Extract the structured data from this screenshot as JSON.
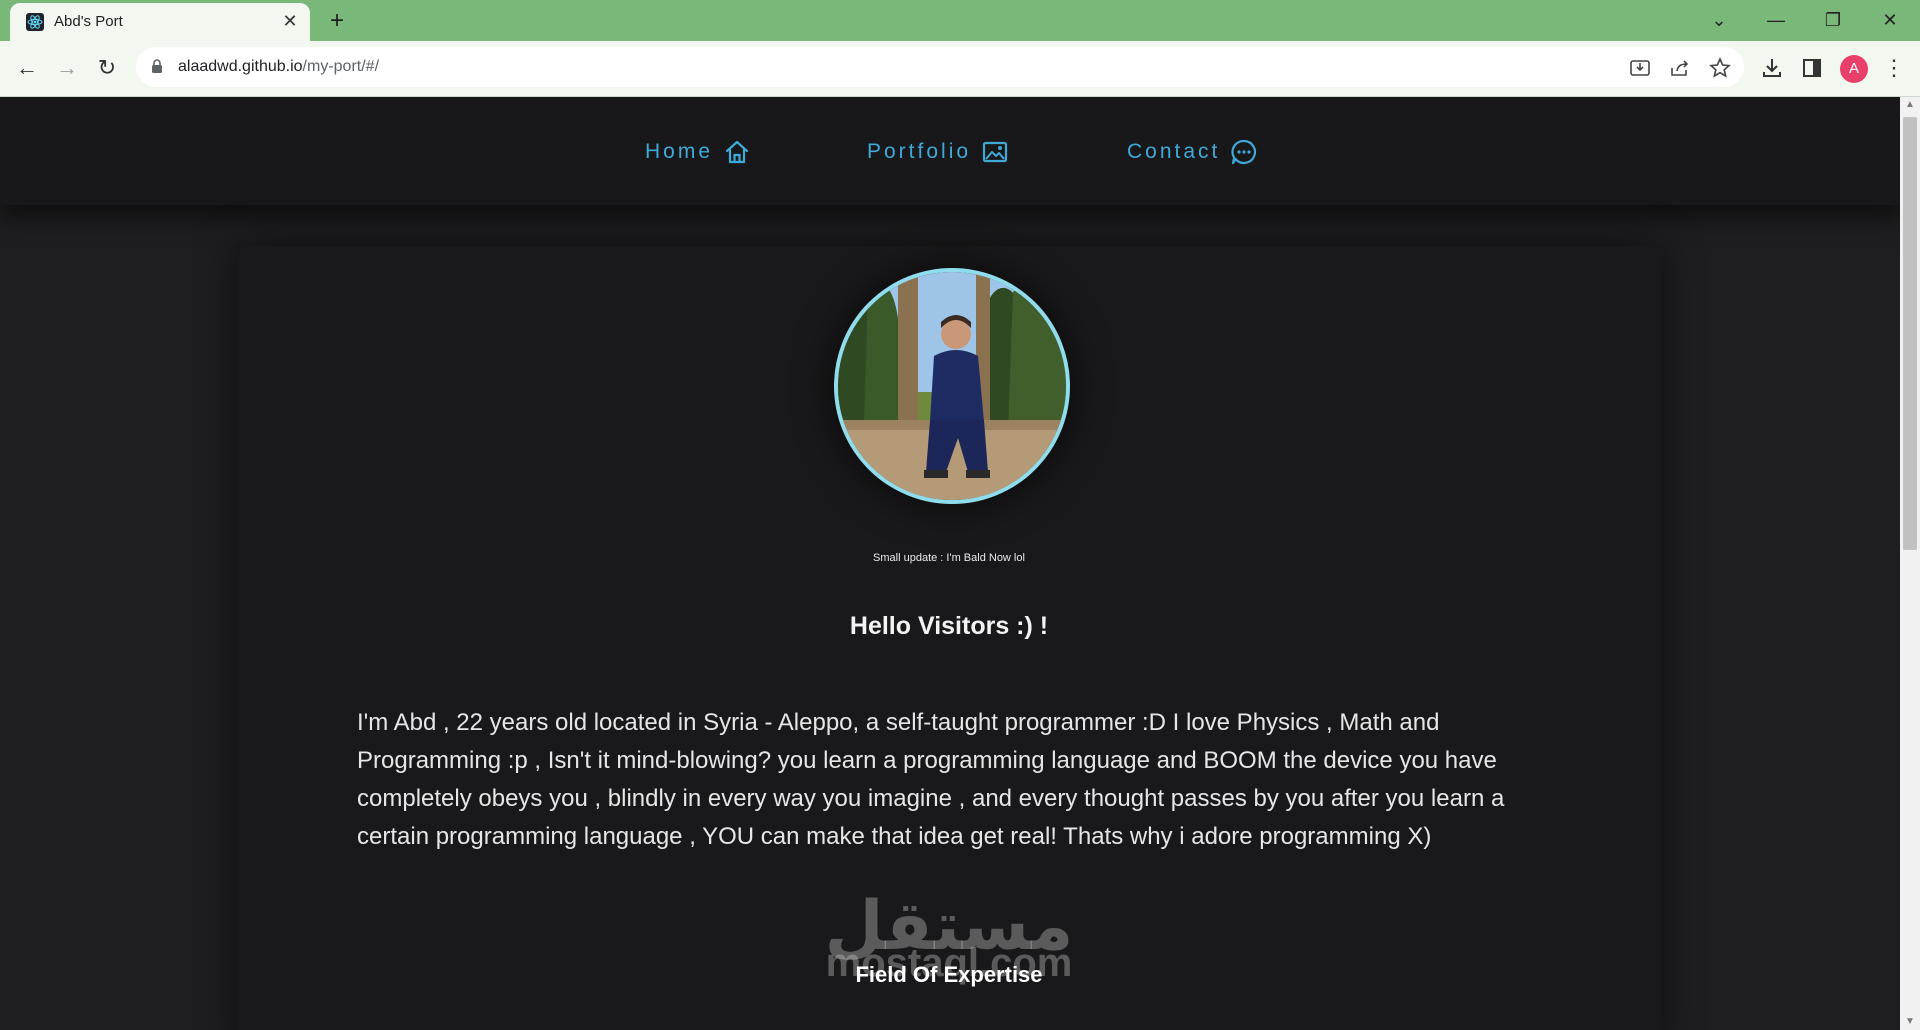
{
  "browser": {
    "tab_title": "Abd's Port",
    "tab_close": "✕",
    "new_tab": "+",
    "url_host": "alaadwd.github.io",
    "url_path": "/my-port/#/",
    "profile_initial": "A",
    "menu": "⋮",
    "window_controls": {
      "tabsearch": "⌄",
      "minimize": "—",
      "restore": "❐",
      "close": "✕"
    },
    "nav": {
      "back": "←",
      "forward": "→",
      "reload": "↻"
    }
  },
  "site": {
    "nav": [
      {
        "label": "Home",
        "icon": "home-icon"
      },
      {
        "label": "Portfolio",
        "icon": "image-icon"
      },
      {
        "label": "Contact",
        "icon": "chat-icon"
      }
    ],
    "accent": "#3fa9d8",
    "profile_ring": "#8fdcec",
    "caption": "Small update : I'm Bald Now lol",
    "heading": "Hello Visitors :) !",
    "bio": "I'm Abd , 22 years old located in Syria - Aleppo, a self-taught programmer :D I love Physics , Math and Programming :p , Isn't it mind-blowing? you learn a programming language and BOOM the device you have completely obeys you , blindly in every way you imagine , and every thought passes by you after you learn a certain programming language , YOU can make that idea get real! Thats why i adore programming X)",
    "watermark_arabic": "مستقل",
    "watermark_latin": "mostaql.com",
    "subheading": "Field Of Expertise"
  }
}
